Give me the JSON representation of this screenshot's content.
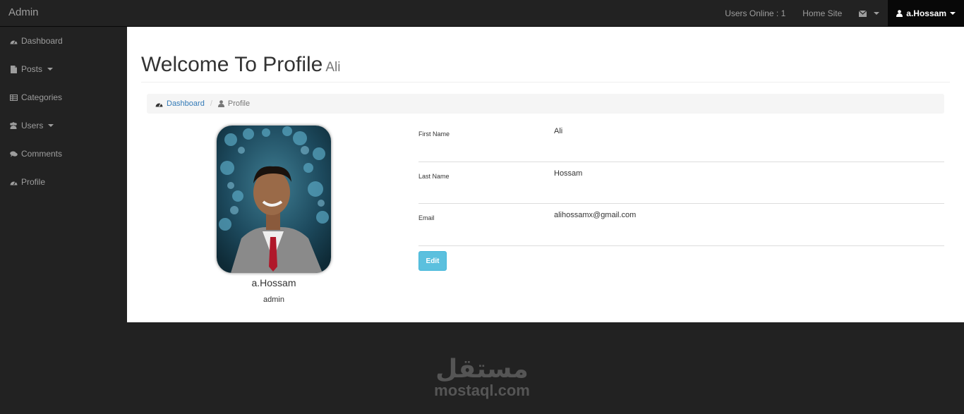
{
  "topbar": {
    "brand": "Admin",
    "users_online": "Users Online : 1",
    "home_site": "Home Site",
    "user_menu": "a.Hossam"
  },
  "sidebar": {
    "items": [
      {
        "label": "Dashboard",
        "icon": "dashboard-icon"
      },
      {
        "label": "Posts",
        "icon": "file-icon",
        "dropdown": true
      },
      {
        "label": "Categories",
        "icon": "table-icon"
      },
      {
        "label": "Users",
        "icon": "users-icon",
        "dropdown": true
      },
      {
        "label": "Comments",
        "icon": "comments-icon"
      },
      {
        "label": "Profile",
        "icon": "dashboard-icon"
      }
    ]
  },
  "page": {
    "title": "Welcome To Profile",
    "subtitle": "Ali"
  },
  "breadcrumb": {
    "link": "Dashboard",
    "active": "Profile"
  },
  "profile": {
    "name": "a.Hossam",
    "role": "admin"
  },
  "info": {
    "first_name_label": "First Name",
    "first_name": "Ali",
    "last_name_label": "Last Name",
    "last_name": "Hossam",
    "email_label": "Email",
    "email": "alihossamx@gmail.com"
  },
  "actions": {
    "edit_label": "Edit"
  },
  "watermark": {
    "arabic": "مستقل",
    "latin": "mostaql.com"
  },
  "colors": {
    "navbar": "#222222",
    "accent_link": "#337ab7",
    "edit_button": "#5bc0de"
  }
}
